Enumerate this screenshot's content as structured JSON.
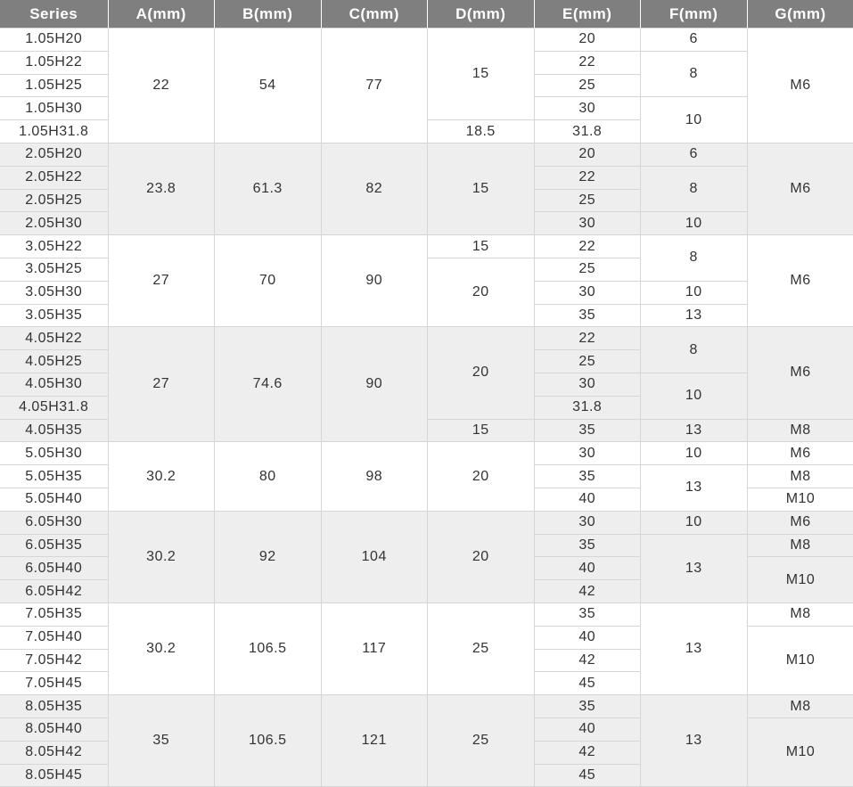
{
  "headers": [
    "Series",
    "A(mm)",
    "B(mm)",
    "C(mm)",
    "D(mm)",
    "E(mm)",
    "F(mm)",
    "G(mm)"
  ],
  "groups": [
    {
      "series": [
        "1.05H20",
        "1.05H22",
        "1.05H25",
        "1.05H30",
        "1.05H31.8"
      ],
      "A": [
        {
          "v": "22",
          "span": 5
        }
      ],
      "B": [
        {
          "v": "54",
          "span": 5
        }
      ],
      "C": [
        {
          "v": "77",
          "span": 5
        }
      ],
      "D": [
        {
          "v": "15",
          "span": 4
        },
        {
          "v": "18.5",
          "span": 1
        }
      ],
      "E": [
        {
          "v": "20",
          "span": 1
        },
        {
          "v": "22",
          "span": 1
        },
        {
          "v": "25",
          "span": 1
        },
        {
          "v": "30",
          "span": 1
        },
        {
          "v": "31.8",
          "span": 1
        }
      ],
      "F": [
        {
          "v": "6",
          "span": 1
        },
        {
          "v": "8",
          "span": 2
        },
        {
          "v": "10",
          "span": 2
        }
      ],
      "G": [
        {
          "v": "M6",
          "span": 5
        }
      ]
    },
    {
      "series": [
        "2.05H20",
        "2.05H22",
        "2.05H25",
        "2.05H30"
      ],
      "A": [
        {
          "v": "23.8",
          "span": 4
        }
      ],
      "B": [
        {
          "v": "61.3",
          "span": 4
        }
      ],
      "C": [
        {
          "v": "82",
          "span": 4
        }
      ],
      "D": [
        {
          "v": "15",
          "span": 4
        }
      ],
      "E": [
        {
          "v": "20",
          "span": 1
        },
        {
          "v": "22",
          "span": 1
        },
        {
          "v": "25",
          "span": 1
        },
        {
          "v": "30",
          "span": 1
        }
      ],
      "F": [
        {
          "v": "6",
          "span": 1
        },
        {
          "v": "8",
          "span": 2
        },
        {
          "v": "10",
          "span": 1
        }
      ],
      "G": [
        {
          "v": "M6",
          "span": 4
        }
      ]
    },
    {
      "series": [
        "3.05H22",
        "3.05H25",
        "3.05H30",
        "3.05H35"
      ],
      "A": [
        {
          "v": "27",
          "span": 4
        }
      ],
      "B": [
        {
          "v": "70",
          "span": 4
        }
      ],
      "C": [
        {
          "v": "90",
          "span": 4
        }
      ],
      "D": [
        {
          "v": "15",
          "span": 1
        },
        {
          "v": "20",
          "span": 3
        }
      ],
      "E": [
        {
          "v": "22",
          "span": 1
        },
        {
          "v": "25",
          "span": 1
        },
        {
          "v": "30",
          "span": 1
        },
        {
          "v": "35",
          "span": 1
        }
      ],
      "F": [
        {
          "v": "8",
          "span": 2
        },
        {
          "v": "10",
          "span": 1
        },
        {
          "v": "13",
          "span": 1
        }
      ],
      "G": [
        {
          "v": "M6",
          "span": 4
        }
      ]
    },
    {
      "series": [
        "4.05H22",
        "4.05H25",
        "4.05H30",
        "4.05H31.8",
        "4.05H35"
      ],
      "A": [
        {
          "v": "27",
          "span": 5
        }
      ],
      "B": [
        {
          "v": "74.6",
          "span": 5
        }
      ],
      "C": [
        {
          "v": "90",
          "span": 5
        }
      ],
      "D": [
        {
          "v": "20",
          "span": 4
        },
        {
          "v": "15",
          "span": 1
        }
      ],
      "E": [
        {
          "v": "22",
          "span": 1
        },
        {
          "v": "25",
          "span": 1
        },
        {
          "v": "30",
          "span": 1
        },
        {
          "v": "31.8",
          "span": 1
        },
        {
          "v": "35",
          "span": 1
        }
      ],
      "F": [
        {
          "v": "8",
          "span": 2
        },
        {
          "v": "10",
          "span": 2
        },
        {
          "v": "13",
          "span": 1
        }
      ],
      "G": [
        {
          "v": "M6",
          "span": 4
        },
        {
          "v": "M8",
          "span": 1
        }
      ]
    },
    {
      "series": [
        "5.05H30",
        "5.05H35",
        "5.05H40"
      ],
      "A": [
        {
          "v": "30.2",
          "span": 3
        }
      ],
      "B": [
        {
          "v": "80",
          "span": 3
        }
      ],
      "C": [
        {
          "v": "98",
          "span": 3
        }
      ],
      "D": [
        {
          "v": "20",
          "span": 3
        }
      ],
      "E": [
        {
          "v": "30",
          "span": 1
        },
        {
          "v": "35",
          "span": 1
        },
        {
          "v": "40",
          "span": 1
        }
      ],
      "F": [
        {
          "v": "10",
          "span": 1
        },
        {
          "v": "13",
          "span": 2
        }
      ],
      "G": [
        {
          "v": "M6",
          "span": 1
        },
        {
          "v": "M8",
          "span": 1
        },
        {
          "v": "M10",
          "span": 1
        }
      ]
    },
    {
      "series": [
        "6.05H30",
        "6.05H35",
        "6.05H40",
        "6.05H42"
      ],
      "A": [
        {
          "v": "30.2",
          "span": 4
        }
      ],
      "B": [
        {
          "v": "92",
          "span": 4
        }
      ],
      "C": [
        {
          "v": "104",
          "span": 4
        }
      ],
      "D": [
        {
          "v": "20",
          "span": 4
        }
      ],
      "E": [
        {
          "v": "30",
          "span": 1
        },
        {
          "v": "35",
          "span": 1
        },
        {
          "v": "40",
          "span": 1
        },
        {
          "v": "42",
          "span": 1
        }
      ],
      "F": [
        {
          "v": "10",
          "span": 1
        },
        {
          "v": "13",
          "span": 3
        }
      ],
      "G": [
        {
          "v": "M6",
          "span": 1
        },
        {
          "v": "M8",
          "span": 1
        },
        {
          "v": "M10",
          "span": 2
        }
      ]
    },
    {
      "series": [
        "7.05H35",
        "7.05H40",
        "7.05H42",
        "7.05H45"
      ],
      "A": [
        {
          "v": "30.2",
          "span": 4
        }
      ],
      "B": [
        {
          "v": "106.5",
          "span": 4
        }
      ],
      "C": [
        {
          "v": "117",
          "span": 4
        }
      ],
      "D": [
        {
          "v": "25",
          "span": 4
        }
      ],
      "E": [
        {
          "v": "35",
          "span": 1
        },
        {
          "v": "40",
          "span": 1
        },
        {
          "v": "42",
          "span": 1
        },
        {
          "v": "45",
          "span": 1
        }
      ],
      "F": [
        {
          "v": "13",
          "span": 4
        }
      ],
      "G": [
        {
          "v": "M8",
          "span": 1
        },
        {
          "v": "M10",
          "span": 3
        }
      ]
    },
    {
      "series": [
        "8.05H35",
        "8.05H40",
        "8.05H42",
        "8.05H45"
      ],
      "A": [
        {
          "v": "35",
          "span": 4
        }
      ],
      "B": [
        {
          "v": "106.5",
          "span": 4
        }
      ],
      "C": [
        {
          "v": "121",
          "span": 4
        }
      ],
      "D": [
        {
          "v": "25",
          "span": 4
        }
      ],
      "E": [
        {
          "v": "35",
          "span": 1
        },
        {
          "v": "40",
          "span": 1
        },
        {
          "v": "42",
          "span": 1
        },
        {
          "v": "45",
          "span": 1
        }
      ],
      "F": [
        {
          "v": "13",
          "span": 4
        }
      ],
      "G": [
        {
          "v": "M8",
          "span": 1
        },
        {
          "v": "M10",
          "span": 3
        }
      ]
    }
  ],
  "colors": {
    "header_bg": "#7f7f7f",
    "header_text": "#ffffff",
    "alt_row_bg": "#eeeeee",
    "grid_line": "#d6d6d6",
    "cell_text": "#333333"
  }
}
